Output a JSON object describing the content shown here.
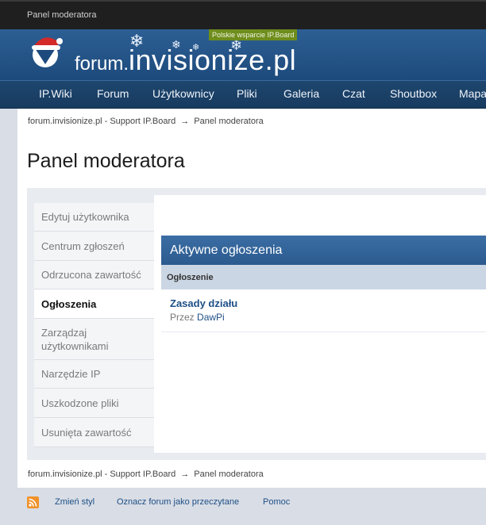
{
  "topbar": {
    "crumb": "Panel moderatora"
  },
  "header": {
    "logo_small": "forum.",
    "logo_big": "invisionize.pl",
    "tagline": "Polskie wsparcie IP.Board"
  },
  "nav": {
    "items": [
      "IP.Wiki",
      "Forum",
      "Użytkownicy",
      "Pliki",
      "Galeria",
      "Czat",
      "Shoutbox",
      "Mapa"
    ]
  },
  "breadcrumb": {
    "root": "forum.invisionize.pl - Support IP.Board",
    "arrow": "→",
    "current": "Panel moderatora"
  },
  "page_title": "Panel moderatora",
  "sidebar": {
    "items": [
      {
        "label": "Edytuj użytkownika"
      },
      {
        "label": "Centrum zgłoszeń"
      },
      {
        "label": "Odrzucona zawartość"
      },
      {
        "label": "Ogłoszenia"
      },
      {
        "label": "Zarządzaj użytkownikami"
      },
      {
        "label": "Narzędzie IP"
      },
      {
        "label": "Uszkodzone pliki"
      },
      {
        "label": "Usunięta zawartość"
      }
    ],
    "active": "Ogłoszenia"
  },
  "announcements": {
    "heading": "Aktywne ogłoszenia",
    "column": "Ogłoszenie",
    "rows": [
      {
        "title": "Zasady działu",
        "by_prefix": "Przez",
        "author": "DawPi"
      }
    ]
  },
  "footer": {
    "change_style": "Zmień styl",
    "mark_read": "Oznacz forum jako przeczytane",
    "help": "Pomoc"
  },
  "colors": {
    "nav_bg": "#1e466f",
    "header_bg": "#2d5f94",
    "accent_link": "#1d4f87",
    "rss": "#f0932a"
  }
}
